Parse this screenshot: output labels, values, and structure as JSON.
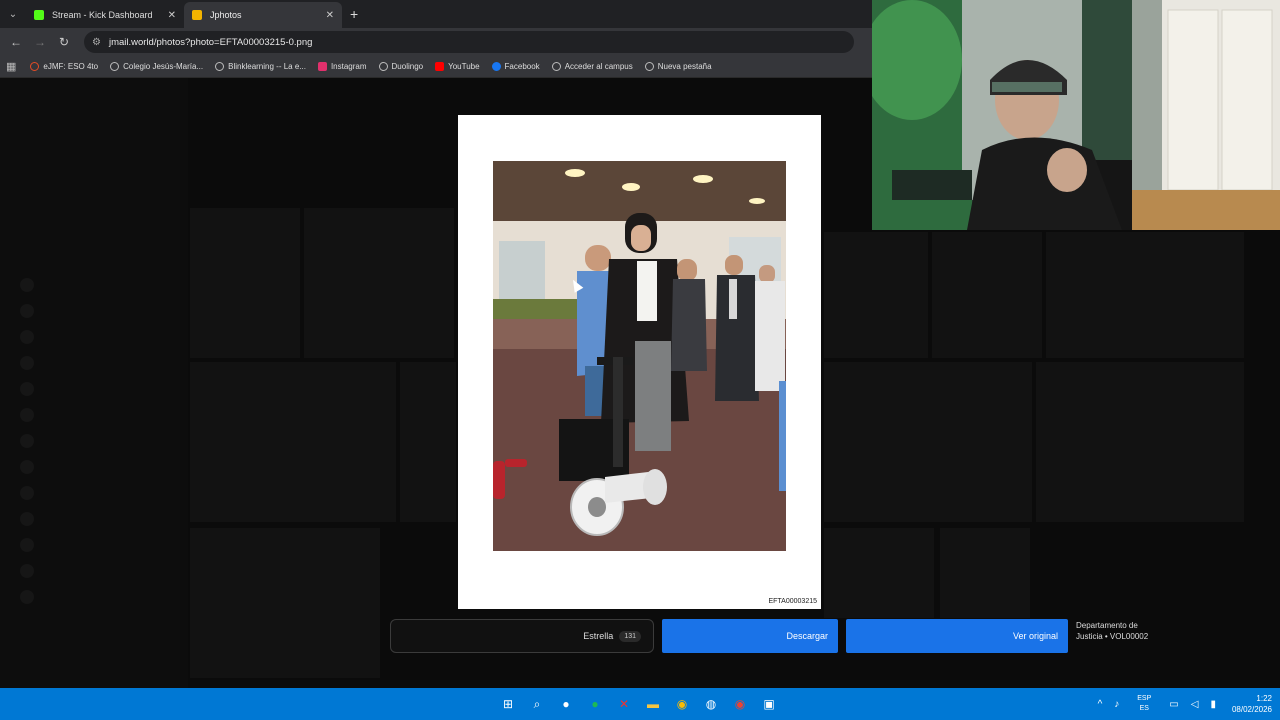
{
  "browser": {
    "tabs": [
      {
        "title": "Stream - Kick Dashboard",
        "favicon_color": "#53fc18",
        "active": false
      },
      {
        "title": "Jphotos",
        "favicon_color": "#f4b400",
        "active": true
      }
    ],
    "url": "jmail.world/photos?photo=EFTA00003215-0.png",
    "bookmarks": [
      {
        "label": "eJMF: ESO 4to",
        "icon_color": "#e34c26"
      },
      {
        "label": "Colegio Jesús-María...",
        "icon_color": "#888888"
      },
      {
        "label": "Blinklearning -- La e...",
        "icon_color": "#888888"
      },
      {
        "label": "Instagram",
        "icon_color": "#e1306c"
      },
      {
        "label": "Duolingo",
        "icon_color": "#888888"
      },
      {
        "label": "YouTube",
        "icon_color": "#ff0000"
      },
      {
        "label": "Facebook",
        "icon_color": "#1877f2"
      },
      {
        "label": "Acceder al campus",
        "icon_color": "#888888"
      },
      {
        "label": "Nueva pestaña",
        "icon_color": "#888888"
      }
    ]
  },
  "modal": {
    "photo_id": "EFTA00003215"
  },
  "actions": {
    "star_label": "Estrella",
    "star_count": "131",
    "download_label": "Descargar",
    "view_original_label": "Ver original",
    "source": "Departamento de Justicia • VOL00002"
  },
  "taskbar": {
    "lang_top": "ESP",
    "lang_bottom": "ES",
    "time": "1:22",
    "date": "08/02/2026",
    "accent": "#0078d4"
  }
}
